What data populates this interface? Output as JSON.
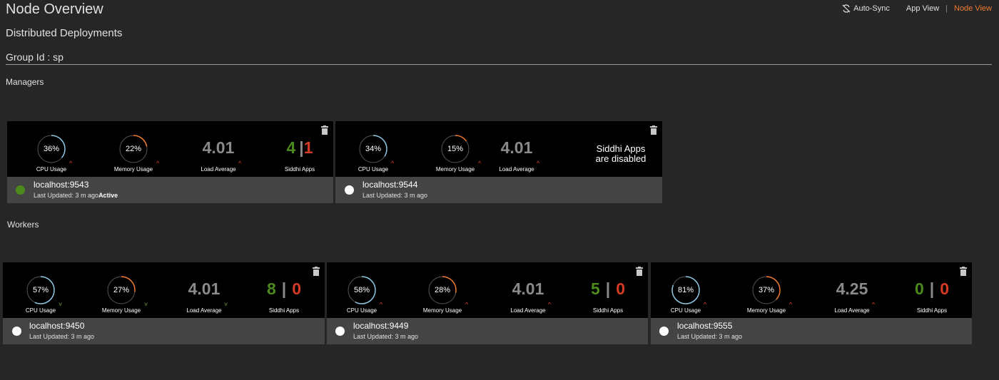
{
  "page": {
    "title": "Node Overview",
    "subtitle": "Distributed Deployments",
    "group": "Group Id : sp"
  },
  "topnav": {
    "auto_sync": "Auto-Sync",
    "app_view": "App View",
    "separator": "|",
    "node_view": "Node View",
    "accent_color": "#f17b31"
  },
  "sections": {
    "managers": "Managers",
    "workers": "Workers"
  },
  "labels": {
    "cpu": "CPU Usage",
    "memory": "Memory Usage",
    "load": "Load Average",
    "apps": "Siddhi Apps",
    "apps_disabled_1": "Siddhi Apps",
    "apps_disabled_2": "are disabled",
    "bar": "|"
  },
  "managers": [
    {
      "host": "localhost:9543",
      "updated": "Last Updated: 3 m ago",
      "status": "Active",
      "status_color": "#4d8a1e",
      "cpu": "36%",
      "cpu_value": 0.36,
      "cpu_trend": "up",
      "memory": "22%",
      "memory_value": 0.22,
      "memory_trend": "up",
      "load": "4.01",
      "load_trend": "up",
      "apps_active": "4",
      "apps_inactive": "1",
      "apps_enabled": true
    },
    {
      "host": "localhost:9544",
      "updated": "Last Updated: 3 m ago",
      "status": "",
      "status_color": "#ffffff",
      "cpu": "34%",
      "cpu_value": 0.34,
      "cpu_trend": "up",
      "memory": "15%",
      "memory_value": 0.15,
      "memory_trend": "up",
      "load": "4.01",
      "load_trend": "up",
      "apps_enabled": false
    }
  ],
  "workers": [
    {
      "host": "localhost:9450",
      "updated": "Last Updated: 3 m ago",
      "status_color": "#ffffff",
      "cpu": "57%",
      "cpu_value": 0.57,
      "cpu_trend": "down",
      "memory": "27%",
      "memory_value": 0.27,
      "memory_trend": "down",
      "load": "4.01",
      "load_trend": "down",
      "apps_active": "8",
      "apps_inactive": "0"
    },
    {
      "host": "localhost:9449",
      "updated": "Last Updated: 3 m ago",
      "status_color": "#ffffff",
      "cpu": "58%",
      "cpu_value": 0.58,
      "cpu_trend": "up",
      "memory": "28%",
      "memory_value": 0.28,
      "memory_trend": "up",
      "load": "4.01",
      "load_trend": "up",
      "apps_active": "5",
      "apps_inactive": "0"
    },
    {
      "host": "localhost:9555",
      "updated": "Last Updated: 3 m ago",
      "status_color": "#ffffff",
      "cpu": "81%",
      "cpu_value": 0.81,
      "cpu_trend": "up",
      "memory": "37%",
      "memory_value": 0.37,
      "memory_trend": "up",
      "load": "4.25",
      "load_trend": "up",
      "apps_active": "0",
      "apps_inactive": "0"
    }
  ],
  "colors": {
    "cpu_gauge": "#8ec9e6",
    "memory_gauge": "#f17b31",
    "trend_up": "#e5432d",
    "trend_down": "#7aa23a"
  }
}
